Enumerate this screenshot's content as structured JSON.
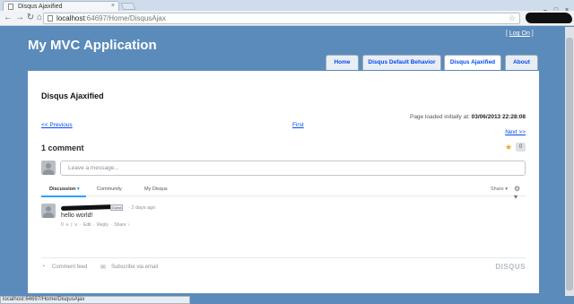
{
  "browser": {
    "tab_title": "Disqus Ajaxified",
    "tab_close": "×",
    "url_host": "localhost",
    "url_rest": ":64697/Home/DisqusAjax",
    "back_icon": "back-arrow-icon",
    "forward_icon": "forward-arrow-icon",
    "reload_icon": "reload-icon",
    "home_icon": "home-icon",
    "window_buttons": [
      "–",
      "□",
      "×"
    ],
    "status_text": "localhost:64697/Home/DisqusAjax"
  },
  "site": {
    "title": "My MVC Application",
    "login_open": "[ ",
    "login_label": "Log On",
    "login_close": " ]",
    "menu": [
      "Home",
      "Disqus Default Behavior",
      "Disqus Ajaxified",
      "About"
    ],
    "active_menu": "Disqus Ajaxified"
  },
  "page": {
    "heading": "Disqus Ajaxified",
    "loaded_prefix": "Page loaded initially at: ",
    "loaded_time": "03/06/2013 22:28:08",
    "prev_link": "<< Previous",
    "first_link": "First",
    "next_link": "Next >>"
  },
  "disqus": {
    "comment_count": "1 comment",
    "favorite_count": "0",
    "message_placeholder": "Leave a message...",
    "tabs": [
      "Discussion",
      "Community",
      "My Disqus"
    ],
    "tab_caret": "▾",
    "share_label": "Share ▾",
    "gear_caret": "⚙ ▾",
    "comment": {
      "badge": "Guest",
      "time": "· 2 days ago",
      "text": "hello world!",
      "actions": "0 ∧ | ∨ · Edit · Reply · Share ›"
    },
    "footer_feed": "Comment feed",
    "footer_email": "Subscribe via email",
    "logo": "DISQUS",
    "accent_color": "#2e9fff"
  }
}
